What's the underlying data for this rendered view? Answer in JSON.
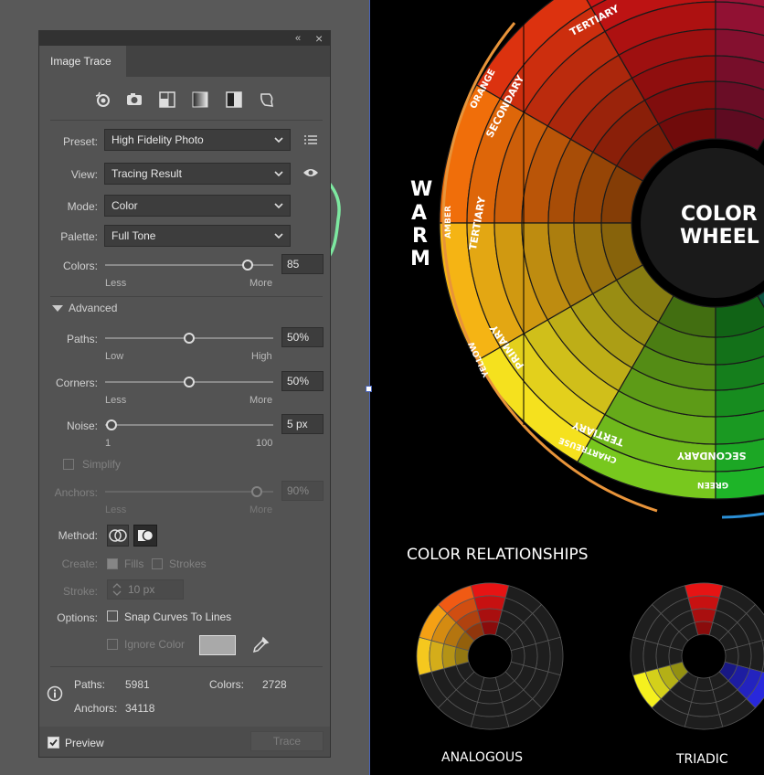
{
  "panel": {
    "tab_label": "Image Trace",
    "collapse_glyph": "«",
    "close_glyph": "×",
    "mode_icons": [
      "auto-color-icon",
      "high-color-icon",
      "low-color-icon",
      "grayscale-icon",
      "black-and-white-icon",
      "outline-icon"
    ],
    "preset_label": "Preset:",
    "preset_value": "High Fidelity Photo",
    "view_label": "View:",
    "view_value": "Tracing Result",
    "mode_label": "Mode:",
    "mode_value": "Color",
    "palette_label": "Palette:",
    "palette_value": "Full Tone",
    "colors": {
      "label": "Colors:",
      "value": "85",
      "min_label": "Less",
      "max_label": "More",
      "level": 0.85
    },
    "advanced_label": "Advanced",
    "paths": {
      "label": "Paths:",
      "value": "50%",
      "min_label": "Low",
      "max_label": "High",
      "level": 0.5
    },
    "corners": {
      "label": "Corners:",
      "value": "50%",
      "min_label": "Less",
      "max_label": "More",
      "level": 0.5
    },
    "noise": {
      "label": "Noise:",
      "value": "5 px",
      "min_label": "1",
      "max_label": "100",
      "level": 0.04
    },
    "simplify_label": "Simplify",
    "anchors": {
      "label": "Anchors:",
      "value": "90%",
      "min_label": "Less",
      "max_label": "More",
      "level": 0.9
    },
    "method_label": "Method:",
    "create_label": "Create:",
    "fills_label": "Fills",
    "strokes_label": "Strokes",
    "stroke_label": "Stroke:",
    "stroke_value": "10 px",
    "options_label": "Options:",
    "snap_label": "Snap Curves To Lines",
    "ignore_color_label": "Ignore Color",
    "ignore_swatch": "#a9a9a9",
    "stats": {
      "paths_label": "Paths:",
      "paths_value": "5981",
      "colors_label": "Colors:",
      "colors_value": "2728",
      "anchors_label": "Anchors:",
      "anchors_value": "34118"
    },
    "preview_label": "Preview",
    "trace_label": "Trace"
  },
  "artwork": {
    "wheel_title_1": "COLOR",
    "wheel_title_2": "WHEEL",
    "warm_letters": [
      "W",
      "A",
      "R",
      "M"
    ],
    "relationships_title": "COLOR RELATIONSHIPS",
    "analogous_label": "ANALOGOUS",
    "triadic_label": "TRIADIC",
    "segment_labels": {
      "tertiary_top": "TERTIARY",
      "orange": "ORANGE",
      "secondary_left": "SECONDARY",
      "amber": "AMBER",
      "tertiary_left": "TERTIARY",
      "yellow": "YELLOW",
      "primary": "PRIMARY",
      "tertiary_bottom": "TERTIARY",
      "chartreuse": "CHARTREUSE",
      "secondary_bottom": "SECONDARY",
      "green": "GREEN"
    }
  },
  "colors": {
    "accent_annotation": "#7de8a0",
    "panel_bg": "#535353",
    "orange_arc": "#e8943a",
    "blue_arc": "#2b8fd6"
  }
}
